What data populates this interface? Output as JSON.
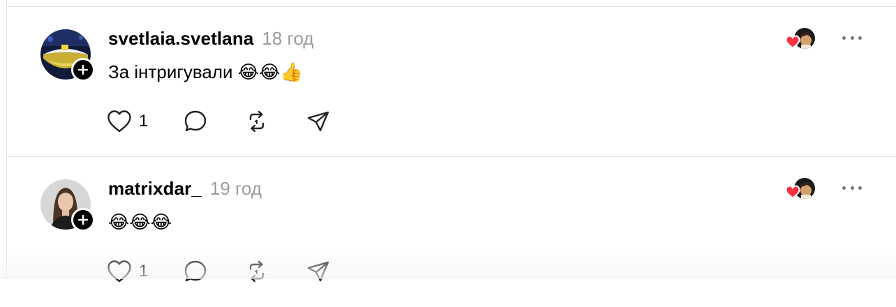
{
  "posts": [
    {
      "username": "svetlaia.svetlana",
      "time": "18 год",
      "text": "За інтригували 😂😂👍",
      "likes": "1",
      "avatar": "avatar-lips-gold-icon",
      "liked_by": "liked-by-avatar"
    },
    {
      "username": "matrixdar_",
      "time": "19 год",
      "text": "😂😂😂",
      "likes": "1",
      "avatar": "avatar-woman-portrait-icon",
      "liked_by": "liked-by-avatar"
    }
  ],
  "icons": {
    "like": "heart-outline-icon",
    "comment": "speech-bubble-icon",
    "repost": "repost-arrows-icon",
    "share": "paper-plane-icon",
    "more": "more-dots-icon",
    "follow": "plus-icon",
    "liked_badge": "red-heart-icon"
  },
  "colors": {
    "text": "#000000",
    "muted": "#9b9b9b",
    "divider": "#e3e3e3",
    "heart": "#ff3040"
  }
}
